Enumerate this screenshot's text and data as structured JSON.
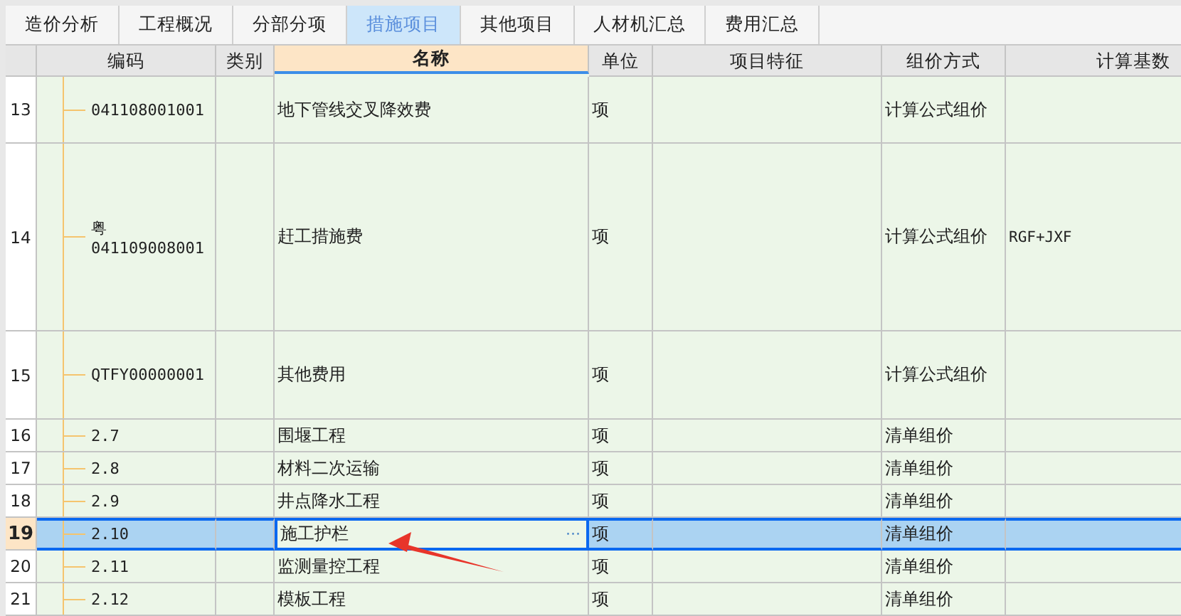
{
  "tabs": [
    {
      "label": "造价分析",
      "selected": false
    },
    {
      "label": "工程概况",
      "selected": false
    },
    {
      "label": "分部分项",
      "selected": false
    },
    {
      "label": "措施项目",
      "selected": true
    },
    {
      "label": "其他项目",
      "selected": false
    },
    {
      "label": "人材机汇总",
      "selected": false
    },
    {
      "label": "费用汇总",
      "selected": false
    }
  ],
  "table": {
    "columns": [
      {
        "label": "编码",
        "selected": false
      },
      {
        "label": "类别",
        "selected": false
      },
      {
        "label": "名称",
        "selected": true
      },
      {
        "label": "单位",
        "selected": false
      },
      {
        "label": "项目特征",
        "selected": false
      },
      {
        "label": "组价方式",
        "selected": false
      },
      {
        "label": "计算基数",
        "selected": false
      }
    ],
    "rows": [
      {
        "number": "13",
        "code": "041108001001",
        "name": "地下管线交叉降效费",
        "unit": "项",
        "method": "计算公式组价",
        "selected": false
      },
      {
        "number": "14",
        "region": "粤",
        "code": "041109008001",
        "name": "赶工措施费",
        "unit": "项",
        "method": "计算公式组价",
        "base": "RGF+JXF",
        "selected": false
      },
      {
        "number": "15",
        "code": "QTFY00000001",
        "name": "其他费用",
        "unit": "项",
        "method": "计算公式组价",
        "selected": false
      },
      {
        "number": "16",
        "code": "2.7",
        "name": "围堰工程",
        "unit": "项",
        "method": "清单组价",
        "selected": false
      },
      {
        "number": "17",
        "code": "2.8",
        "name": "材料二次运输",
        "unit": "项",
        "method": "清单组价",
        "selected": false
      },
      {
        "number": "18",
        "code": "2.9",
        "name": "井点降水工程",
        "unit": "项",
        "method": "清单组价",
        "selected": false
      },
      {
        "number": "19",
        "code": "2.10",
        "name": "施工护栏",
        "unit": "项",
        "method": "清单组价",
        "selected": true,
        "edit_button": "···"
      },
      {
        "number": "20",
        "code": "2.11",
        "name": "监测量控工程",
        "unit": "项",
        "method": "清单组价",
        "selected": false
      },
      {
        "number": "21",
        "code": "2.12",
        "name": "模板工程",
        "unit": "项",
        "method": "清单组价",
        "selected": false
      }
    ]
  }
}
